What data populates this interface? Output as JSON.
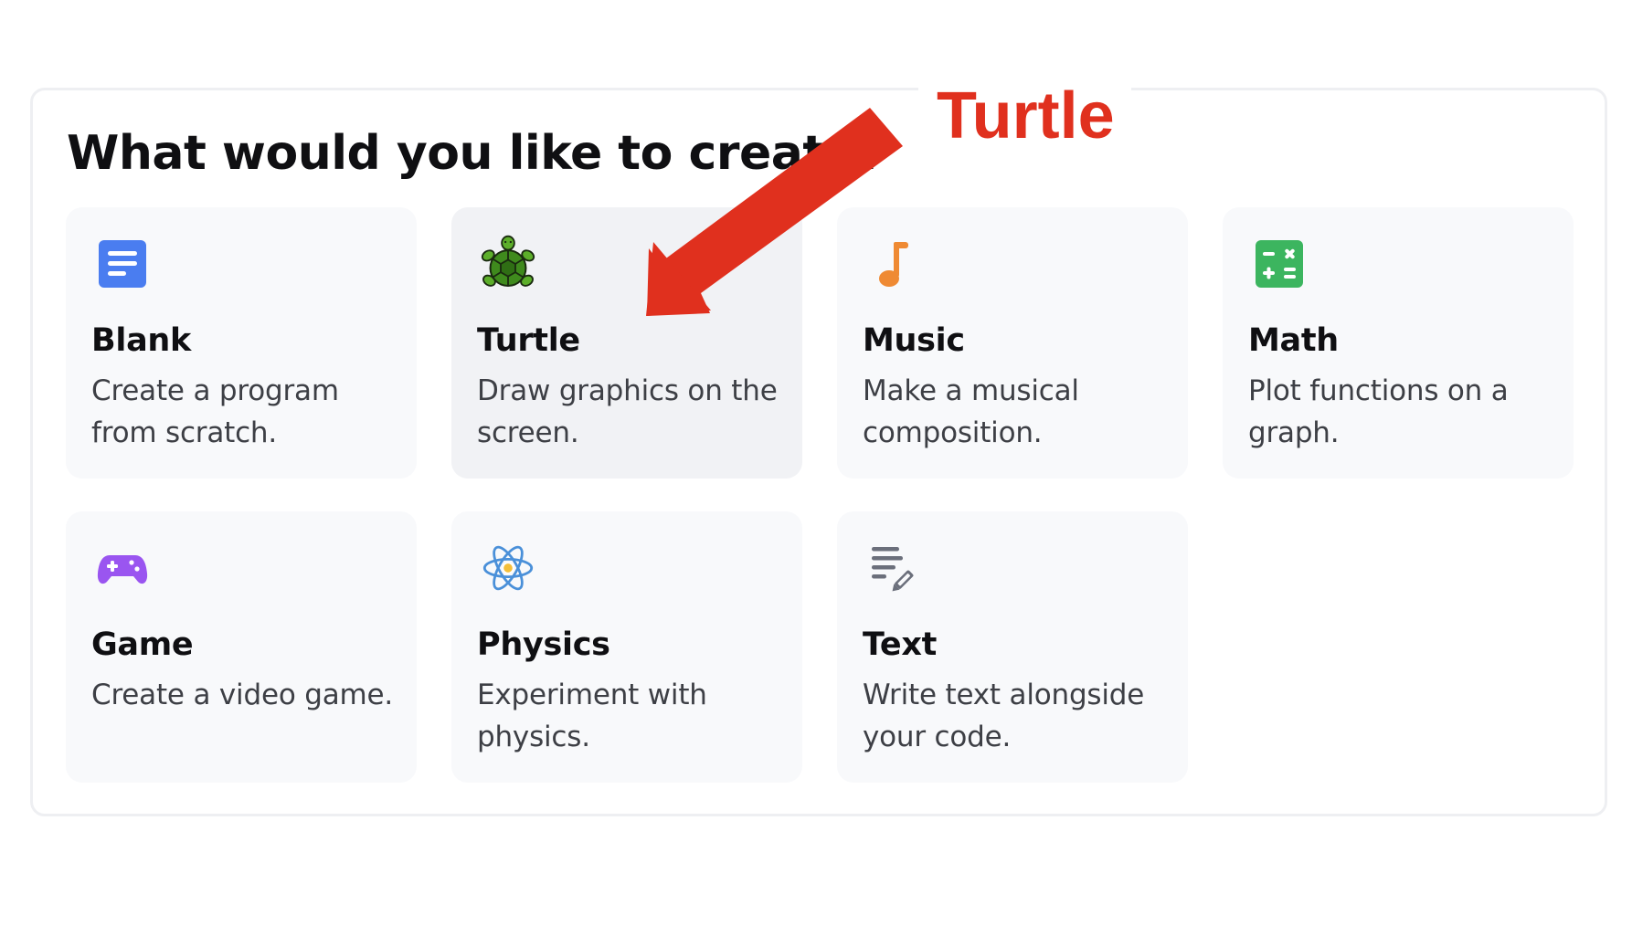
{
  "heading": "What would you like to create?",
  "cards": [
    {
      "title": "Blank",
      "description": "Create a program from scratch.",
      "icon": "document-icon",
      "color": "#4a7df0"
    },
    {
      "title": "Turtle",
      "description": "Draw graphics on the screen.",
      "icon": "turtle-icon",
      "color": "#3a8a1c"
    },
    {
      "title": "Music",
      "description": "Make a musical composition.",
      "icon": "music-note-icon",
      "color": "#ef8a33"
    },
    {
      "title": "Math",
      "description": "Plot functions on a graph.",
      "icon": "calculator-icon",
      "color": "#3cb55f"
    },
    {
      "title": "Game",
      "description": "Create a video game.",
      "icon": "gamepad-icon",
      "color": "#9a55f0"
    },
    {
      "title": "Physics",
      "description": "Experiment with physics.",
      "icon": "atom-icon",
      "color": "#4a90d9"
    },
    {
      "title": "Text",
      "description": "Write text alongside your code.",
      "icon": "text-edit-icon",
      "color": "#6b6f7b"
    }
  ],
  "selected": "Turtle",
  "annotation": {
    "label": "Turtle",
    "color": "#e0301e"
  }
}
